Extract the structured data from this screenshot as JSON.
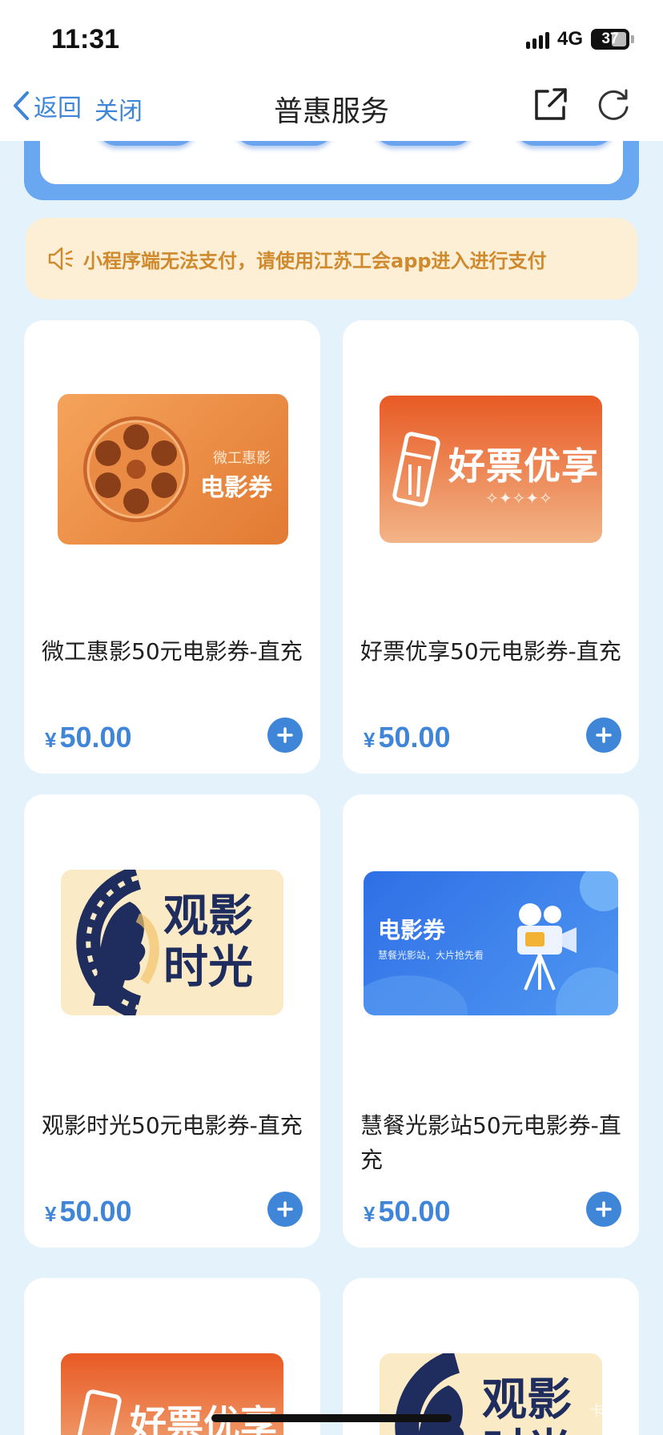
{
  "status_bar": {
    "time": "11:31",
    "network": "4G",
    "battery": "37"
  },
  "nav": {
    "back_label": "返回",
    "close_label": "关闭",
    "title": "普惠服务"
  },
  "notice": {
    "text": "小程序端无法支付，请使用江苏工会app进入进行支付"
  },
  "products": [
    {
      "name": "微工惠影50元电影券-直充",
      "currency": "¥",
      "price": "50.00",
      "image_tag": "微工惠影",
      "image_title": "电影券",
      "image_colors": [
        "#f29b52",
        "#e27a32"
      ]
    },
    {
      "name": "好票优享50元电影券-直充",
      "currency": "¥",
      "price": "50.00",
      "image_title": "好票优享",
      "image_deco": "✧✦✧✦✧",
      "image_colors": [
        "#e85a24",
        "#f2b487"
      ]
    },
    {
      "name": "观影时光50元电影券-直充",
      "currency": "¥",
      "price": "50.00",
      "image_title_line1": "观影",
      "image_title_line2": "时光",
      "image_colors": [
        "#faebc6",
        "#1f2c5e"
      ]
    },
    {
      "name": "慧餐光影站50元电影券-直充",
      "currency": "¥",
      "price": "50.00",
      "image_title": "电影券",
      "image_subtitle": "慧餐光影站，大片抢先看",
      "image_colors": [
        "#2f6fe6",
        "#5aa4f4"
      ]
    },
    {
      "image_title": "好票优享",
      "image_colors": [
        "#e85a24",
        "#f2b487"
      ]
    },
    {
      "image_title_line1": "观影",
      "image_title_line2": "时光",
      "image_colors": [
        "#faebc6",
        "#1f2c5e"
      ]
    }
  ],
  "watermark": "卡"
}
